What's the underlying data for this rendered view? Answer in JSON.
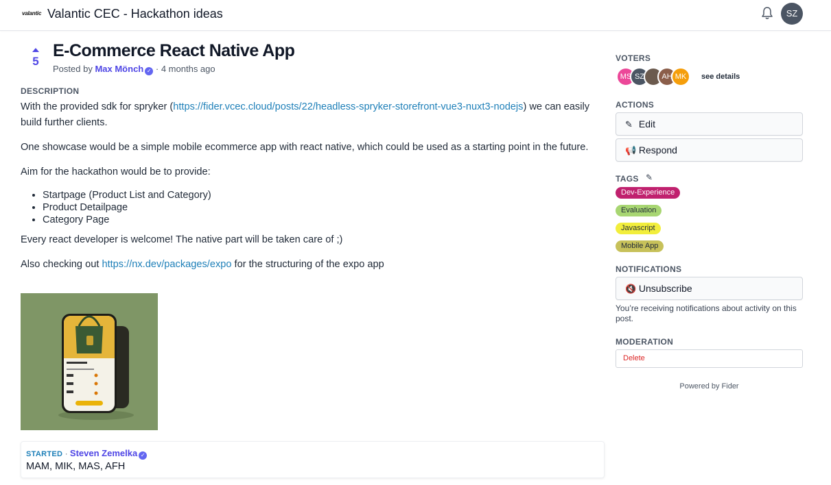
{
  "header": {
    "logo_text": "valantic",
    "site_title": "Valantic CEC - Hackathon ideas",
    "user_initials": "SZ"
  },
  "post": {
    "vote_count": "5",
    "title": "E-Commerce React Native App",
    "posted_by_prefix": "Posted by",
    "author": "Max Mönch",
    "separator": "·",
    "time_ago": "4 months ago",
    "description_label": "DESCRIPTION",
    "p1_before": "With the provided sdk for spryker (",
    "p1_link": "https://fider.vcec.cloud/posts/22/headless-spryker-storefront-vue3-nuxt3-nodejs",
    "p1_after": ") we can easily build further clients.",
    "p2": "One showcase would be a simple mobile ecommerce app with react native, which could be used as a starting point in the future.",
    "p3": "Aim for the hackathon would be to provide:",
    "list": [
      "Startpage (Product List and Category)",
      "Product Detailpage",
      "Category Page"
    ],
    "p4": "Every react developer is welcome! The native part will be taken care of ;)",
    "p5_before": "Also checking out ",
    "p5_link": "https://nx.dev/packages/expo",
    "p5_after": " for the structuring of the expo app"
  },
  "status": {
    "tag": "STARTED",
    "separator": "·",
    "author": "Steven Zemelka",
    "text": "MAM, MIK, MAS, AFH"
  },
  "sidebar": {
    "voters_label": "VOTERS",
    "voters": [
      {
        "initials": "MS",
        "color": "#ec4899"
      },
      {
        "initials": "SZ",
        "color": "#4b5563"
      },
      {
        "initials": "",
        "color": "#6b5a4e"
      },
      {
        "initials": "AH",
        "color": "#8b5e4a"
      },
      {
        "initials": "MK",
        "color": "#f59e0b"
      }
    ],
    "see_details": "see details",
    "actions_label": "ACTIONS",
    "edit_label": "Edit",
    "respond_label": "Respond",
    "tags_label": "TAGS",
    "tags": [
      "Dev-Experience",
      "Evaluation",
      "Javascript",
      "Mobile App"
    ],
    "notifications_label": "NOTIFICATIONS",
    "unsubscribe_label": "Unsubscribe",
    "notifications_text": "You’re receiving notifications about activity on this post.",
    "moderation_label": "MODERATION",
    "delete_label": "Delete",
    "powered_by": "Powered by Fider"
  },
  "colors": {
    "accent": "#4f46e5",
    "link": "#1d7fb8",
    "tag_dev_experience": "#c0216e",
    "tag_evaluation": "#a8d672",
    "tag_javascript": "#f2ee3c",
    "tag_mobile_app": "#c7c15a",
    "danger": "#dc2626"
  },
  "icons": {
    "bell": "bell-icon",
    "upvote": "upvote-arrow-icon",
    "verified": "verified-badge-icon",
    "edit": "edit-icon",
    "respond": "megaphone-icon",
    "unsubscribe": "mute-icon",
    "tags_edit": "edit-icon"
  }
}
